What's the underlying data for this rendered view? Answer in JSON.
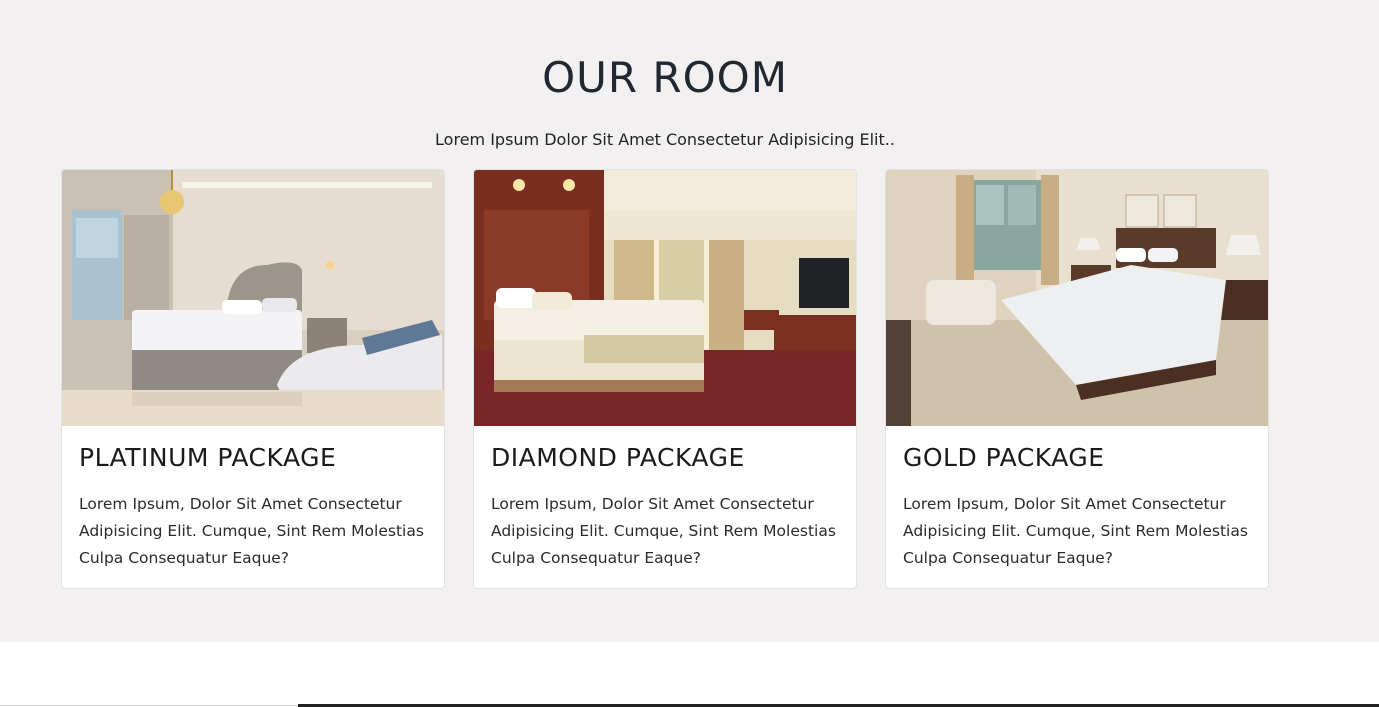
{
  "section": {
    "title": "OUR ROOM",
    "subtitle": "Lorem Ipsum Dolor Sit Amet Consectetur Adipisicing Elit.."
  },
  "cards": [
    {
      "title": "PLATINUM PACKAGE",
      "text": "Lorem Ipsum, Dolor Sit Amet Consectetur Adipisicing Elit. Cumque, Sint Rem Molestias Culpa Consequatur Eaque?",
      "image": "room-photo"
    },
    {
      "title": "DIAMOND PACKAGE",
      "text": "Lorem Ipsum, Dolor Sit Amet Consectetur Adipisicing Elit. Cumque, Sint Rem Molestias Culpa Consequatur Eaque?",
      "image": "room-photo"
    },
    {
      "title": "GOLD PACKAGE",
      "text": "Lorem Ipsum, Dolor Sit Amet Consectetur Adipisicing Elit. Cumque, Sint Rem Molestias Culpa Consequatur Eaque?",
      "image": "room-photo"
    }
  ],
  "colors": {
    "section_bg": "#f2f0f1",
    "card_bg": "#ffffff",
    "heading": "#222831"
  }
}
